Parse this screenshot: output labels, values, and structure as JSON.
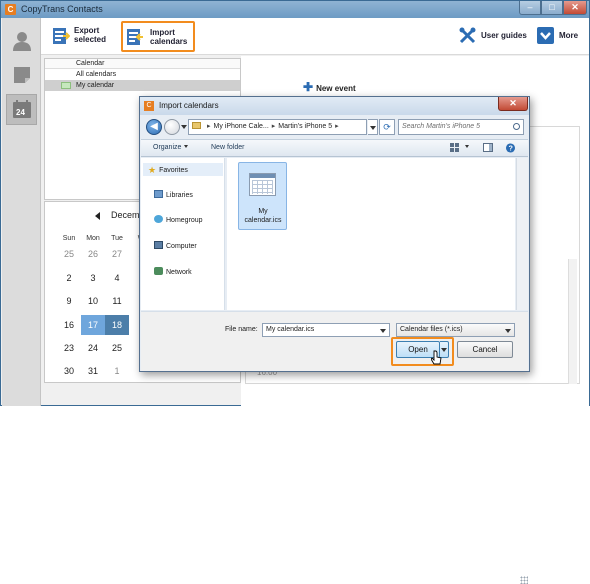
{
  "window": {
    "title": "CopyTrans Contacts",
    "app_icon_letter": "C"
  },
  "toolbar": {
    "export_line1": "Export",
    "export_line2": "selected",
    "import_line1": "Import",
    "import_line2": "calendars",
    "user_guides": "User guides",
    "more": "More"
  },
  "left_nav": {
    "calendar_day": "24"
  },
  "calendar_list": {
    "header": "Calendar",
    "rows": [
      "All calendars",
      "My calendar"
    ],
    "selected_color": "#c6e8bd"
  },
  "main": {
    "new_event": "New event",
    "time_label": "16:00"
  },
  "mini_calendar": {
    "month_label": "Decem",
    "weekdays": [
      "Sun",
      "Mon",
      "Tue",
      "W"
    ],
    "weeks": [
      [
        "25",
        "26",
        "27",
        "2"
      ],
      [
        "2",
        "3",
        "4",
        ""
      ],
      [
        "9",
        "10",
        "11",
        ""
      ],
      [
        "16",
        "17",
        "18",
        ""
      ],
      [
        "23",
        "24",
        "25",
        ""
      ],
      [
        "30",
        "31",
        "1",
        ""
      ]
    ]
  },
  "dialog": {
    "title": "Import calendars",
    "breadcrumb": [
      "My iPhone Cale...",
      "Martin's iPhone 5"
    ],
    "search_placeholder": "Search Martin's iPhone 5",
    "organize": "Organize",
    "new_folder": "New folder",
    "nav": {
      "favorites": "Favorites",
      "libraries": "Libraries",
      "homegroup": "Homegroup",
      "computer": "Computer",
      "network": "Network"
    },
    "file_name": "My calendar.ics",
    "file_name_label": "File name:",
    "file_name_value": "My calendar.ics",
    "file_type": "Calendar files (*.ics)",
    "open": "Open",
    "cancel": "Cancel"
  },
  "colors": {
    "highlight": "#f28c1e",
    "accent": "#2b6cb3",
    "selected_day": "#6fa6dc"
  }
}
